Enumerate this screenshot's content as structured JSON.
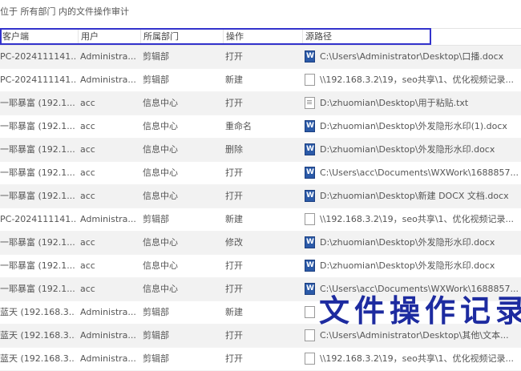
{
  "topbar": {
    "location_text": "位于 所有部门 内的文件操作审计"
  },
  "columns": [
    "客户端",
    "用户",
    "所属部门",
    "操作",
    "源路径"
  ],
  "rows": [
    {
      "client": "PC-2024111141...",
      "user": "Administra...",
      "dept": "剪辑部",
      "op": "打开",
      "icon": "word-doc-icon",
      "path": "C:\\Users\\Administrator\\Desktop\\口播.docx"
    },
    {
      "client": "PC-2024111141...",
      "user": "Administra...",
      "dept": "剪辑部",
      "op": "新建",
      "icon": "file-icon",
      "path": "\\\\192.168.3.2\\19，seo共享\\1、优化视频记录..."
    },
    {
      "client": "一耶暴富 (192.1...",
      "user": "acc",
      "dept": "信息中心",
      "op": "打开",
      "icon": "text-file-icon",
      "path": "D:\\zhuomian\\Desktop\\用于粘贴.txt"
    },
    {
      "client": "一耶暴富 (192.1...",
      "user": "acc",
      "dept": "信息中心",
      "op": "重命名",
      "icon": "word-doc-icon",
      "path": "D:\\zhuomian\\Desktop\\外发隐形水印(1).docx"
    },
    {
      "client": "一耶暴富 (192.1...",
      "user": "acc",
      "dept": "信息中心",
      "op": "删除",
      "icon": "word-doc-icon",
      "path": "D:\\zhuomian\\Desktop\\外发隐形水印.docx"
    },
    {
      "client": "一耶暴富 (192.1...",
      "user": "acc",
      "dept": "信息中心",
      "op": "打开",
      "icon": "word-doc-icon",
      "path": "C:\\Users\\acc\\Documents\\WXWork\\1688857..."
    },
    {
      "client": "一耶暴富 (192.1...",
      "user": "acc",
      "dept": "信息中心",
      "op": "打开",
      "icon": "word-doc-icon",
      "path": "D:\\zhuomian\\Desktop\\新建 DOCX 文档.docx"
    },
    {
      "client": "PC-2024111141...",
      "user": "Administra...",
      "dept": "剪辑部",
      "op": "新建",
      "icon": "file-icon",
      "path": "\\\\192.168.3.2\\19，seo共享\\1、优化视频记录..."
    },
    {
      "client": "一耶暴富 (192.1...",
      "user": "acc",
      "dept": "信息中心",
      "op": "修改",
      "icon": "word-doc-icon",
      "path": "D:\\zhuomian\\Desktop\\外发隐形水印.docx"
    },
    {
      "client": "一耶暴富 (192.1...",
      "user": "acc",
      "dept": "信息中心",
      "op": "打开",
      "icon": "word-doc-icon",
      "path": "D:\\zhuomian\\Desktop\\外发隐形水印.docx"
    },
    {
      "client": "一耶暴富 (192.1...",
      "user": "acc",
      "dept": "信息中心",
      "op": "打开",
      "icon": "word-doc-icon",
      "path": "C:\\Users\\acc\\Documents\\WXWork\\1688857..."
    },
    {
      "client": "蓝天 (192.168.3...",
      "user": "Administra...",
      "dept": "剪辑部",
      "op": "新建",
      "icon": "file-icon",
      "path": ""
    },
    {
      "client": "蓝天 (192.168.3...",
      "user": "Administra...",
      "dept": "剪辑部",
      "op": "打开",
      "icon": "file-icon",
      "path": "C:\\Users\\Administrator\\Desktop\\其他\\文本..."
    },
    {
      "client": "蓝天 (192.168.3...",
      "user": "Administra...",
      "dept": "剪辑部",
      "op": "打开",
      "icon": "file-icon",
      "path": "\\\\192.168.3.2\\19，seo共享\\1、优化视频记录..."
    }
  ],
  "watermark_text": "文件操作记录",
  "colors": {
    "highlight": "#3333cc",
    "watermark": "#1d2ba0",
    "alt_row": "#f2f2f2"
  }
}
